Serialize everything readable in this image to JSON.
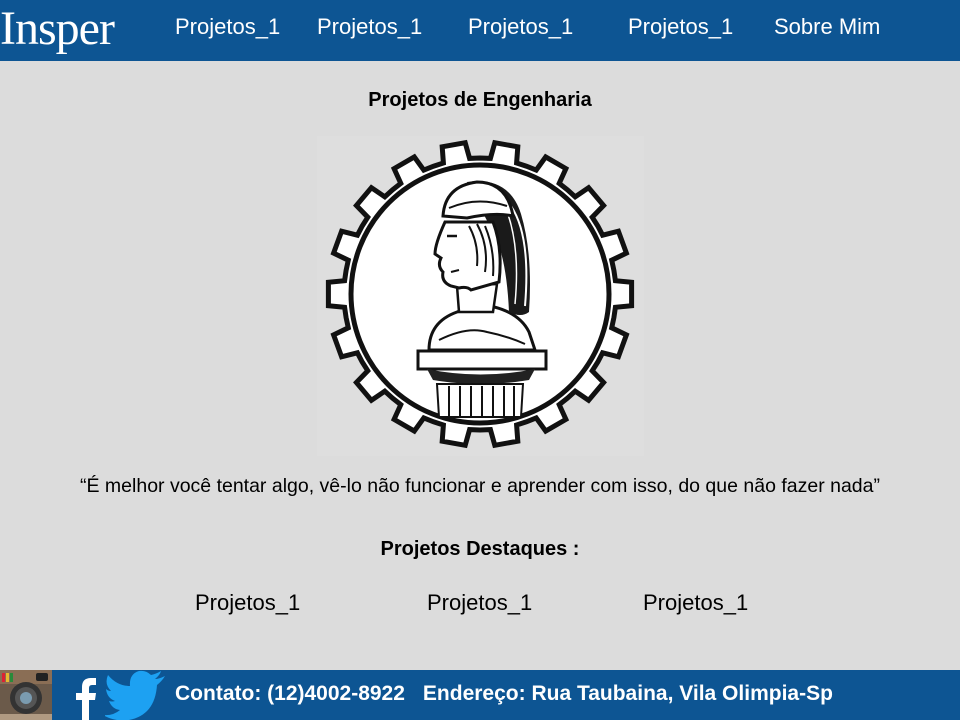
{
  "header": {
    "logo_text": "Insper",
    "nav": [
      {
        "label": "Projetos_1"
      },
      {
        "label": "Projetos_1"
      },
      {
        "label": "Projetos_1"
      },
      {
        "label": "Projetos_1"
      },
      {
        "label": "Sobre Mim"
      }
    ]
  },
  "main": {
    "title": "Projetos de Engenharia",
    "seal_icon": "engineering-school-seal",
    "quote": "“É melhor você tentar algo, vê-lo não funcionar e aprender com isso, do que não fazer nada”",
    "featured": {
      "title": "Projetos Destaques :",
      "items": [
        {
          "label": "Projetos_1"
        },
        {
          "label": "Projetos_1"
        },
        {
          "label": "Projetos_1"
        }
      ]
    }
  },
  "footer": {
    "social_icons": [
      "instagram-icon",
      "facebook-icon",
      "twitter-icon"
    ],
    "contact": "Contato: (12)4002-8922",
    "address": "Endereço: Rua Taubaina, Vila Olimpia-Sp"
  },
  "colors": {
    "brand_blue": "#0d5593",
    "background": "#dcdcdc",
    "twitter_blue": "#1da1f2"
  }
}
